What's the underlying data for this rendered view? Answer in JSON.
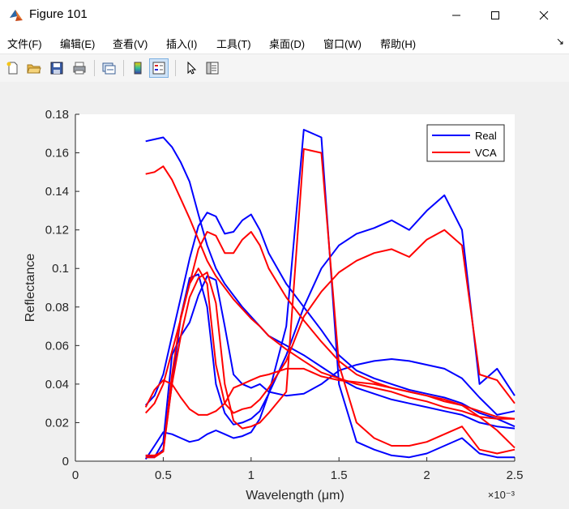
{
  "window": {
    "title": "Figure 101"
  },
  "menu": {
    "items": [
      "文件(F)",
      "编辑(E)",
      "查看(V)",
      "插入(I)",
      "工具(T)",
      "桌面(D)",
      "窗口(W)",
      "帮助(H)"
    ]
  },
  "toolbar": {
    "buttons": [
      {
        "name": "new-figure-icon"
      },
      {
        "name": "open-file-icon"
      },
      {
        "name": "save-icon"
      },
      {
        "name": "print-icon"
      },
      {
        "name": "link-plot-icon"
      },
      {
        "name": "insert-colorbar-icon"
      },
      {
        "name": "insert-legend-icon"
      },
      {
        "name": "edit-plot-pointer-icon"
      },
      {
        "name": "property-inspector-icon"
      }
    ]
  },
  "colors": {
    "real": "#0000ff",
    "vca": "#ff0000"
  },
  "chart_data": {
    "type": "line",
    "xlabel": "Wavelength (μm)",
    "ylabel": "Reflectance",
    "x_exponent_label": "×10⁻³",
    "xlim": [
      0,
      0.0025
    ],
    "ylim": [
      0,
      0.18
    ],
    "xticks": [
      0,
      0.0005,
      0.001,
      0.0015,
      0.002,
      0.0025
    ],
    "xtick_labels": [
      "0",
      "0.5",
      "1",
      "1.5",
      "2",
      "2.5"
    ],
    "yticks": [
      0,
      0.02,
      0.04,
      0.06,
      0.08,
      0.1,
      0.12,
      0.14,
      0.16,
      0.18
    ],
    "ytick_labels": [
      "0",
      "0.02",
      "0.04",
      "0.06",
      "0.08",
      "0.1",
      "0.12",
      "0.14",
      "0.16",
      "0.18"
    ],
    "legend": {
      "position": "top-right",
      "entries": [
        "Real",
        "VCA"
      ]
    },
    "series": [
      {
        "name": "Real",
        "color": "#0000ff",
        "x": [
          0.0004,
          0.00045,
          0.0005,
          0.00055,
          0.0006,
          0.00065,
          0.0007,
          0.00075,
          0.0008,
          0.00085,
          0.0009,
          0.00095,
          0.001,
          0.00105,
          0.0011,
          0.0012,
          0.0013,
          0.0014,
          0.0015,
          0.0016,
          0.0017,
          0.0018,
          0.0019,
          0.002,
          0.0021,
          0.0022,
          0.0023,
          0.0024,
          0.0025
        ],
        "y": [
          0.166,
          0.167,
          0.168,
          0.163,
          0.155,
          0.145,
          0.128,
          0.112,
          0.1,
          0.092,
          0.086,
          0.08,
          0.075,
          0.07,
          0.065,
          0.06,
          0.055,
          0.049,
          0.043,
          0.038,
          0.035,
          0.032,
          0.03,
          0.028,
          0.026,
          0.024,
          0.02,
          0.018,
          0.017
        ]
      },
      {
        "name": "Real",
        "color": "#0000ff",
        "x": [
          0.0004,
          0.00045,
          0.0005,
          0.00055,
          0.0006,
          0.00065,
          0.0007,
          0.00075,
          0.0008,
          0.00085,
          0.0009,
          0.00095,
          0.001,
          0.00105,
          0.0011,
          0.0012,
          0.0013,
          0.0014,
          0.0015,
          0.0016,
          0.0017,
          0.0018,
          0.0019,
          0.002,
          0.0021,
          0.0022,
          0.0023,
          0.0024,
          0.0025
        ],
        "y": [
          0.029,
          0.034,
          0.045,
          0.065,
          0.085,
          0.105,
          0.122,
          0.129,
          0.127,
          0.118,
          0.119,
          0.125,
          0.128,
          0.12,
          0.108,
          0.092,
          0.08,
          0.068,
          0.055,
          0.047,
          0.043,
          0.04,
          0.037,
          0.035,
          0.033,
          0.03,
          0.025,
          0.022,
          0.018
        ]
      },
      {
        "name": "Real",
        "color": "#0000ff",
        "x": [
          0.0004,
          0.00045,
          0.0005,
          0.00055,
          0.0006,
          0.00065,
          0.0007,
          0.00075,
          0.0008,
          0.00085,
          0.0009,
          0.00095,
          0.001,
          0.00105,
          0.0011,
          0.0012,
          0.0013,
          0.0014,
          0.0015,
          0.0016,
          0.0017,
          0.0018,
          0.0019,
          0.002,
          0.0021,
          0.0022,
          0.0023,
          0.0024,
          0.0025
        ],
        "y": [
          0.003,
          0.002,
          0.01,
          0.055,
          0.065,
          0.072,
          0.086,
          0.096,
          0.094,
          0.07,
          0.045,
          0.04,
          0.038,
          0.04,
          0.036,
          0.034,
          0.035,
          0.04,
          0.047,
          0.05,
          0.052,
          0.053,
          0.052,
          0.05,
          0.048,
          0.043,
          0.033,
          0.024,
          0.026
        ]
      },
      {
        "name": "Real",
        "color": "#0000ff",
        "x": [
          0.0004,
          0.00045,
          0.0005,
          0.00055,
          0.0006,
          0.00065,
          0.0007,
          0.00075,
          0.0008,
          0.00085,
          0.0009,
          0.00095,
          0.001,
          0.00105,
          0.0011,
          0.0012,
          0.0013,
          0.0014,
          0.0015,
          0.0016,
          0.0017,
          0.0018,
          0.0019,
          0.002,
          0.0021,
          0.0022,
          0.0023,
          0.0024,
          0.0025
        ],
        "y": [
          0.001,
          0.008,
          0.015,
          0.014,
          0.012,
          0.01,
          0.011,
          0.014,
          0.016,
          0.014,
          0.012,
          0.013,
          0.015,
          0.022,
          0.035,
          0.07,
          0.172,
          0.168,
          0.04,
          0.01,
          0.006,
          0.003,
          0.002,
          0.004,
          0.008,
          0.012,
          0.004,
          0.002,
          0.002
        ]
      },
      {
        "name": "Real",
        "color": "#0000ff",
        "x": [
          0.0004,
          0.00045,
          0.0005,
          0.00055,
          0.0006,
          0.00065,
          0.0007,
          0.00075,
          0.0008,
          0.00085,
          0.0009,
          0.00095,
          0.001,
          0.00105,
          0.0011,
          0.0012,
          0.0013,
          0.0014,
          0.0015,
          0.0016,
          0.0017,
          0.0018,
          0.0019,
          0.002,
          0.0021,
          0.0022,
          0.0023,
          0.0024,
          0.0025
        ],
        "y": [
          0.002,
          0.002,
          0.006,
          0.04,
          0.075,
          0.095,
          0.097,
          0.08,
          0.04,
          0.025,
          0.019,
          0.02,
          0.022,
          0.026,
          0.035,
          0.055,
          0.08,
          0.1,
          0.112,
          0.118,
          0.121,
          0.125,
          0.12,
          0.13,
          0.138,
          0.12,
          0.04,
          0.048,
          0.034
        ]
      },
      {
        "name": "VCA",
        "color": "#ff0000",
        "x": [
          0.0004,
          0.00045,
          0.0005,
          0.00055,
          0.0006,
          0.00065,
          0.0007,
          0.00075,
          0.0008,
          0.00085,
          0.0009,
          0.00095,
          0.001,
          0.00105,
          0.0011,
          0.0012,
          0.0013,
          0.0014,
          0.0015,
          0.0016,
          0.0017,
          0.0018,
          0.0019,
          0.002,
          0.0021,
          0.0022,
          0.0023,
          0.0024,
          0.0025
        ],
        "y": [
          0.149,
          0.15,
          0.153,
          0.146,
          0.136,
          0.126,
          0.115,
          0.104,
          0.096,
          0.09,
          0.084,
          0.079,
          0.074,
          0.07,
          0.065,
          0.058,
          0.052,
          0.046,
          0.043,
          0.04,
          0.038,
          0.036,
          0.033,
          0.031,
          0.028,
          0.026,
          0.023,
          0.022,
          0.022
        ]
      },
      {
        "name": "VCA",
        "color": "#ff0000",
        "x": [
          0.0004,
          0.00045,
          0.0005,
          0.00055,
          0.0006,
          0.00065,
          0.0007,
          0.00075,
          0.0008,
          0.00085,
          0.0009,
          0.00095,
          0.001,
          0.00105,
          0.0011,
          0.0012,
          0.0013,
          0.0014,
          0.0015,
          0.0016,
          0.0017,
          0.0018,
          0.0019,
          0.002,
          0.0021,
          0.0022,
          0.0023,
          0.0024,
          0.0025
        ],
        "y": [
          0.025,
          0.03,
          0.04,
          0.057,
          0.074,
          0.092,
          0.11,
          0.119,
          0.117,
          0.108,
          0.108,
          0.115,
          0.119,
          0.112,
          0.1,
          0.085,
          0.073,
          0.062,
          0.052,
          0.045,
          0.041,
          0.038,
          0.036,
          0.034,
          0.032,
          0.029,
          0.026,
          0.023,
          0.022
        ]
      },
      {
        "name": "VCA",
        "color": "#ff0000",
        "x": [
          0.0004,
          0.00045,
          0.0005,
          0.00055,
          0.0006,
          0.00065,
          0.0007,
          0.00075,
          0.0008,
          0.00085,
          0.0009,
          0.00095,
          0.001,
          0.00105,
          0.0011,
          0.0012,
          0.0013,
          0.0014,
          0.0015,
          0.0016,
          0.0017,
          0.0018,
          0.0019,
          0.002,
          0.0021,
          0.0022,
          0.0023,
          0.0024,
          0.0025
        ],
        "y": [
          0.028,
          0.037,
          0.042,
          0.04,
          0.033,
          0.027,
          0.024,
          0.024,
          0.026,
          0.03,
          0.038,
          0.04,
          0.042,
          0.044,
          0.045,
          0.048,
          0.048,
          0.044,
          0.042,
          0.041,
          0.04,
          0.038,
          0.036,
          0.034,
          0.031,
          0.029,
          0.023,
          0.016,
          0.007
        ]
      },
      {
        "name": "VCA",
        "color": "#ff0000",
        "x": [
          0.0004,
          0.00045,
          0.0005,
          0.00055,
          0.0006,
          0.00065,
          0.0007,
          0.00075,
          0.0008,
          0.00085,
          0.0009,
          0.00095,
          0.001,
          0.00105,
          0.0011,
          0.0012,
          0.0013,
          0.0014,
          0.0015,
          0.0016,
          0.0017,
          0.0018,
          0.0019,
          0.002,
          0.0021,
          0.0022,
          0.0023,
          0.0024,
          0.0025
        ],
        "y": [
          0.002,
          0.002,
          0.005,
          0.04,
          0.065,
          0.085,
          0.095,
          0.098,
          0.082,
          0.04,
          0.021,
          0.017,
          0.018,
          0.02,
          0.025,
          0.036,
          0.162,
          0.16,
          0.05,
          0.02,
          0.012,
          0.008,
          0.008,
          0.01,
          0.014,
          0.018,
          0.006,
          0.004,
          0.006
        ]
      },
      {
        "name": "VCA",
        "color": "#ff0000",
        "x": [
          0.0004,
          0.00045,
          0.0005,
          0.00055,
          0.0006,
          0.00065,
          0.0007,
          0.00075,
          0.0008,
          0.00085,
          0.0009,
          0.00095,
          0.001,
          0.00105,
          0.0011,
          0.0012,
          0.0013,
          0.0014,
          0.0015,
          0.0016,
          0.0017,
          0.0018,
          0.0019,
          0.002,
          0.0021,
          0.0022,
          0.0023,
          0.0024,
          0.0025
        ],
        "y": [
          0.003,
          0.003,
          0.005,
          0.045,
          0.075,
          0.092,
          0.1,
          0.092,
          0.05,
          0.03,
          0.025,
          0.027,
          0.028,
          0.032,
          0.038,
          0.052,
          0.075,
          0.088,
          0.098,
          0.104,
          0.108,
          0.11,
          0.106,
          0.115,
          0.12,
          0.112,
          0.045,
          0.042,
          0.03
        ]
      }
    ]
  }
}
